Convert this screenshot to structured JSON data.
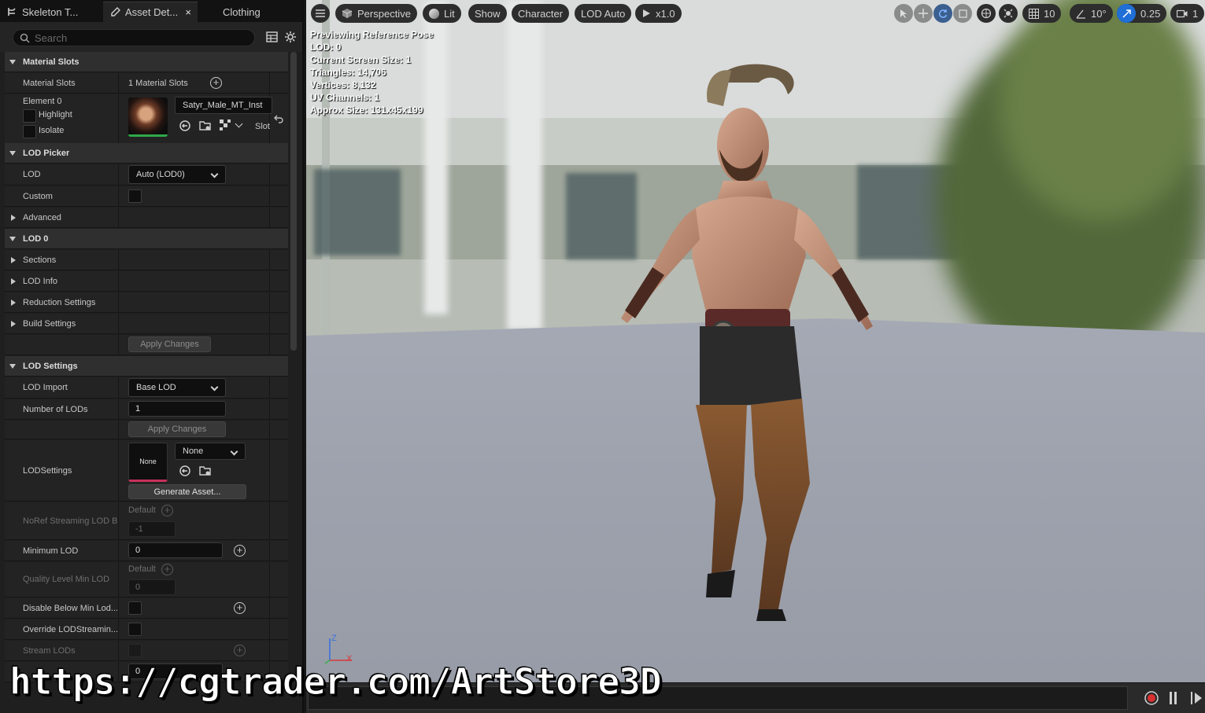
{
  "tabs": [
    {
      "label": "Skeleton T...",
      "icon": "skeleton-icon"
    },
    {
      "label": "Asset Det...",
      "icon": "brush-icon",
      "close": "×"
    },
    {
      "label": "Clothing"
    }
  ],
  "search": {
    "placeholder": "Search"
  },
  "material_slots": {
    "category": "Material Slots",
    "name": "Material Slots",
    "count": "1 Material Slots",
    "element": "Element 0",
    "highlight": "Highlight",
    "isolate": "Isolate",
    "material": "Satyr_Male_MT_Inst",
    "slot": "Slot"
  },
  "lod_picker": {
    "category": "LOD Picker",
    "lod_label": "LOD",
    "lod_value": "Auto (LOD0)",
    "custom_label": "Custom",
    "advanced_label": "Advanced"
  },
  "lod0": {
    "category": "LOD 0",
    "sections": "Sections",
    "lod_info": "LOD Info",
    "reduction": "Reduction Settings",
    "build": "Build Settings",
    "apply": "Apply Changes"
  },
  "lod_settings": {
    "category": "LOD Settings",
    "import_label": "LOD Import",
    "import_value": "Base LOD",
    "num_label": "Number of LODs",
    "num_value": "1",
    "apply": "Apply Changes",
    "settings_label": "LODSettings",
    "settings_thumb": "None",
    "settings_value": "None",
    "generate": "Generate Asset...",
    "noref_label": "NoRef Streaming LOD B",
    "noref_default": "Default",
    "noref_value": "-1",
    "min_lod_label": "Minimum LOD",
    "min_lod_value": "0",
    "quality_label": "Quality Level Min LOD",
    "quality_default": "Default",
    "quality_value": "0",
    "disable_below_label": "Disable Below Min Lod...",
    "override_label": "Override LODStreamin...",
    "stream_label": "Stream LODs",
    "max_streamed_value": "0"
  },
  "viewport": {
    "perspective": "Perspective",
    "lit": "Lit",
    "show": "Show",
    "character": "Character",
    "lod_auto": "LOD Auto",
    "speed": "x1.0",
    "grid": "10",
    "angle": "10°",
    "scale": "0.25",
    "camera": "1"
  },
  "stats": [
    "Previewing Reference Pose",
    "LOD: 0",
    "Current Screen Size: 1",
    "Triangles: 14,706",
    "Vertices: 8,132",
    "UV Channels: 1",
    "Approx Size: 131x45x199"
  ],
  "gizmo": {
    "z": "Z",
    "x": "X"
  },
  "watermark": "https://cgtrader.com/ArtStore3D",
  "colors": {
    "accent": "#1f6fd6",
    "record": "#d93030",
    "panel": "#232323"
  }
}
